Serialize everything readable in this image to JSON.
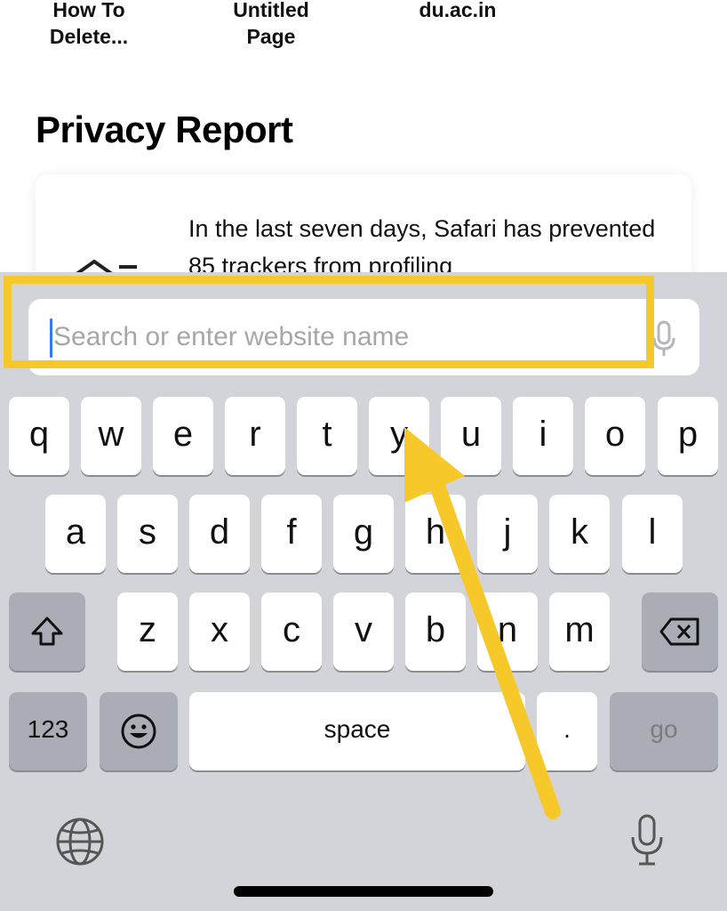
{
  "favorites": [
    {
      "label": "How To\nDelete..."
    },
    {
      "label": "Untitled\nPage"
    },
    {
      "label": "du.ac.in"
    }
  ],
  "privacy": {
    "title": "Privacy Report",
    "text": "In the last seven days, Safari has prevented 85 trackers from profiling"
  },
  "url_bar": {
    "placeholder": "Search or enter website name",
    "value": ""
  },
  "keyboard": {
    "row1": [
      "q",
      "w",
      "e",
      "r",
      "t",
      "y",
      "u",
      "i",
      "o",
      "p"
    ],
    "row2": [
      "a",
      "s",
      "d",
      "f",
      "g",
      "h",
      "j",
      "k",
      "l"
    ],
    "row3": [
      "z",
      "x",
      "c",
      "v",
      "b",
      "n",
      "m"
    ],
    "numbers_label": "123",
    "space_label": "space",
    "period_label": ".",
    "go_label": "go"
  },
  "colors": {
    "highlight": "#f6c82a",
    "keyboard_bg": "#d3d4da",
    "caret": "#3478f6"
  },
  "icons": [
    "shift-icon",
    "backspace-icon",
    "emoji-icon",
    "globe-icon",
    "dictation-mic-icon",
    "url-mic-icon",
    "arrow-annotation"
  ]
}
